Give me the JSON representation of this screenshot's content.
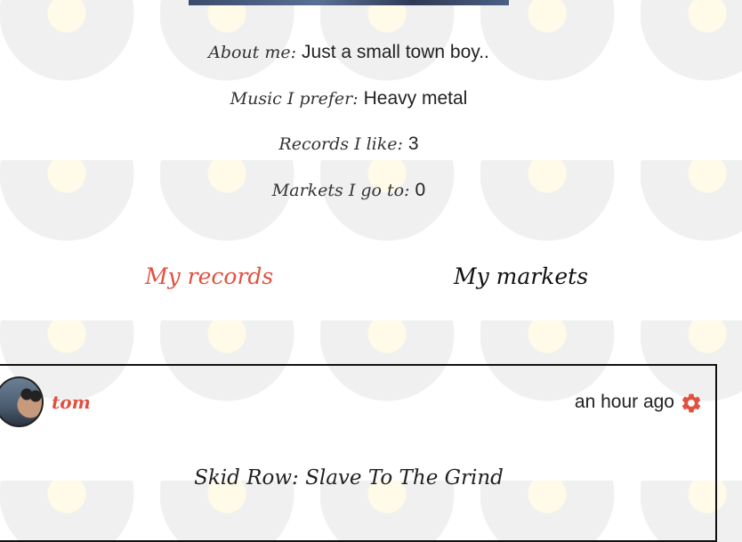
{
  "profile": {
    "about": {
      "label": "About me:",
      "value": "Just a small town boy.."
    },
    "music": {
      "label": "Music I prefer:",
      "value": "Heavy metal"
    },
    "records": {
      "label": "Records I like:",
      "value": "3"
    },
    "markets": {
      "label": "Markets I go to:",
      "value": "0"
    }
  },
  "tabs": {
    "records": "My records",
    "markets": "My markets"
  },
  "post": {
    "username": "tom",
    "timestamp": "an hour ago",
    "title": "Skid Row: Slave To The Grind"
  },
  "colors": {
    "accent": "#e2513f",
    "text": "#222222"
  },
  "icons": {
    "settings": "gear-icon"
  }
}
